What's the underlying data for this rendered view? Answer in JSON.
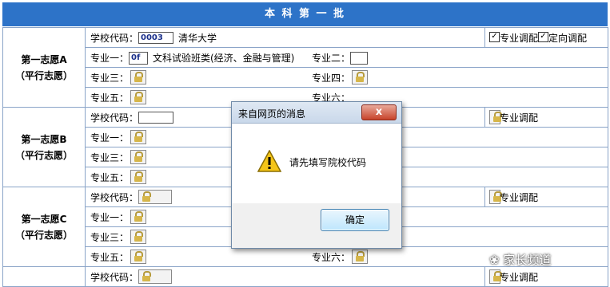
{
  "header": {
    "title": "本 科 第 一 批"
  },
  "choices": [
    {
      "name_line1": "第一志愿A",
      "name_line2": "（平行志愿）",
      "school_code_label": "学校代码：",
      "school_code_value": "0003",
      "school_name": "清华大学",
      "major_adjust_label": "专业调配",
      "direct_adjust_label": "定向调配",
      "major1_label": "专业一：",
      "major1_code": "0f",
      "major1_name": "文科试验班类(经济、金融与管理)",
      "major2_label": "专业二：",
      "major3_label": "专业三：",
      "major4_label": "专业四：",
      "major5_label": "专业五：",
      "major6_label": "专业六："
    },
    {
      "name_line1": "第一志愿B",
      "name_line2": "（平行志愿）",
      "school_code_label": "学校代码：",
      "major_adjust_label": "专业调配",
      "major1_label": "专业一：",
      "major3_label": "专业三：",
      "major5_label": "专业五："
    },
    {
      "name_line1": "第一志愿C",
      "name_line2": "（平行志愿）",
      "school_code_label": "学校代码：",
      "major_adjust_label": "专业调配",
      "major1_label": "专业一：",
      "major3_label": "专业三：",
      "major5_label": "专业五：",
      "major6_label": "专业六："
    },
    {
      "school_code_label": "学校代码：",
      "major_adjust_label": "专业调配"
    }
  ],
  "dialog": {
    "title": "来自网页的消息",
    "close": "x",
    "message": "请先填写院校代码",
    "ok_button": "确定"
  },
  "watermark": {
    "text": "家长频道"
  },
  "icons": {
    "lock": "lock-icon",
    "warning": "warning-icon",
    "checkbox": "checkbox-icon"
  }
}
